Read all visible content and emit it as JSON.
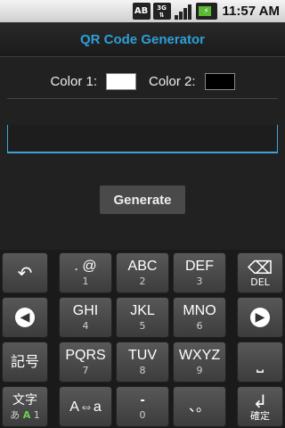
{
  "status_bar": {
    "ab_label": "AB",
    "network_label": "3G",
    "time": "11:57 AM"
  },
  "app": {
    "title": "QR Code Generator",
    "color1_label": "Color 1:",
    "color2_label": "Color 2:",
    "color1_value": "#ffffff",
    "color2_value": "#000000",
    "text_input_value": "",
    "generate_label": "Generate",
    "accent_color": "#2e9fd7"
  },
  "keyboard": {
    "undo_icon": "↶",
    "delete_label": "DEL",
    "delete_icon": "⌫",
    "kigou_label": "記号",
    "space_icon": "⎵",
    "mode_main": "文字",
    "mode_sub_kana": "あ",
    "mode_sub_alpha": "A",
    "mode_sub_num": "1",
    "confirm_icon": "↲",
    "confirm_label": "確定",
    "rows": [
      [
        {
          "main": ". @",
          "sub": "1"
        },
        {
          "main": "ABC",
          "sub": "2"
        },
        {
          "main": "DEF",
          "sub": "3"
        }
      ],
      [
        {
          "main": "GHI",
          "sub": "4"
        },
        {
          "main": "JKL",
          "sub": "5"
        },
        {
          "main": "MNO",
          "sub": "6"
        }
      ],
      [
        {
          "main": "PQRS",
          "sub": "7"
        },
        {
          "main": "TUV",
          "sub": "8"
        },
        {
          "main": "WXYZ",
          "sub": "9"
        }
      ],
      [
        {
          "main": "A⇔a",
          "sub": ""
        },
        {
          "main": "-",
          "sub": "0"
        },
        {
          "main": "、。",
          "sub": ""
        }
      ]
    ]
  }
}
